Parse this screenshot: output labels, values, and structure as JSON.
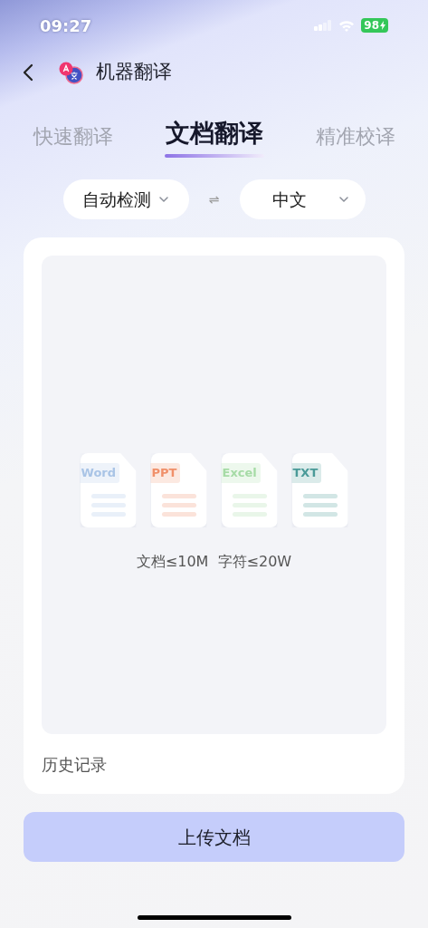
{
  "status_bar": {
    "time": "09:27",
    "battery": "98"
  },
  "header": {
    "title": "机器翻译"
  },
  "tabs": [
    {
      "label": "快速翻译",
      "selected": false
    },
    {
      "label": "文档翻译",
      "selected": true
    },
    {
      "label": "精准校译",
      "selected": false
    }
  ],
  "languages": {
    "source": "自动检测",
    "swap": "⇌",
    "target": "中文"
  },
  "upload_area": {
    "file_types": [
      {
        "label": "Word",
        "color": "#a9c4e6"
      },
      {
        "label": "PPT",
        "color": "#f0906a"
      },
      {
        "label": "Excel",
        "color": "#a6dba6"
      },
      {
        "label": "TXT",
        "color": "#4a9a98"
      }
    ],
    "limits": "文档≤10M  字符≤20W"
  },
  "history_link": "历史记录",
  "upload_button": "上传文档"
}
